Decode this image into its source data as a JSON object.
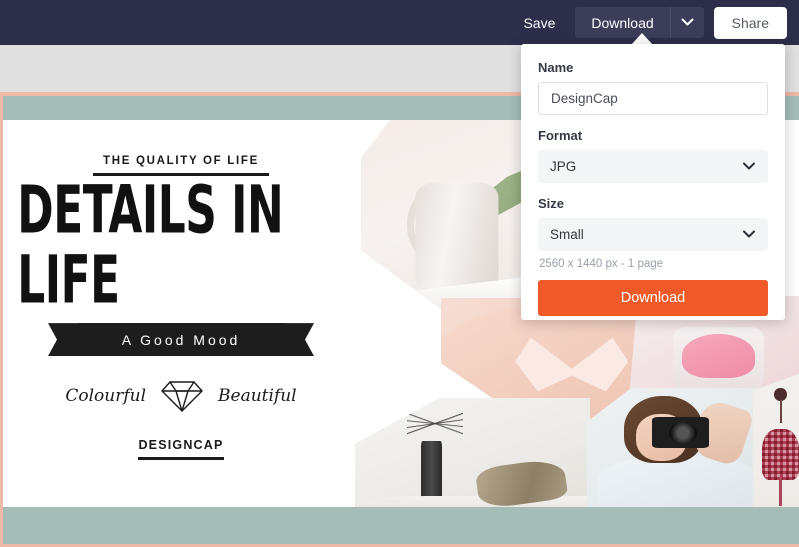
{
  "topbar": {
    "save_label": "Save",
    "download_label": "Download",
    "caret_icon": "chevron-down-icon",
    "share_label": "Share"
  },
  "download_panel": {
    "name_label": "Name",
    "name_value": "DesignCap",
    "name_placeholder": "DesignCap",
    "format_label": "Format",
    "format_value": "JPG",
    "format_caret_icon": "chevron-down-icon",
    "size_label": "Size",
    "size_value": "Small",
    "size_caret_icon": "chevron-down-icon",
    "dimensions_hint": "2560 x 1440 px - 1 page",
    "download_button_label": "Download",
    "accent_color": "#f05a28"
  },
  "canvas": {
    "border_color": "#efb9a8",
    "band_color": "#a4bdb6",
    "kicker": "THE QUALITY OF LIFE",
    "title": "DETAILS IN LIFE",
    "ribbon_text": "A Good Mood",
    "script_left": "Colourful",
    "script_right": "Beautiful",
    "diamond_icon": "diamond-icon",
    "brand": "DESIGNCAP",
    "photos": [
      {
        "name": "photo-pitcher"
      },
      {
        "name": "photo-butterfly-in-hand"
      },
      {
        "name": "photo-pink-bowl"
      },
      {
        "name": "photo-vase-and-pillows"
      },
      {
        "name": "photo-woman-with-camera"
      },
      {
        "name": "photo-hanging-bag"
      }
    ]
  }
}
